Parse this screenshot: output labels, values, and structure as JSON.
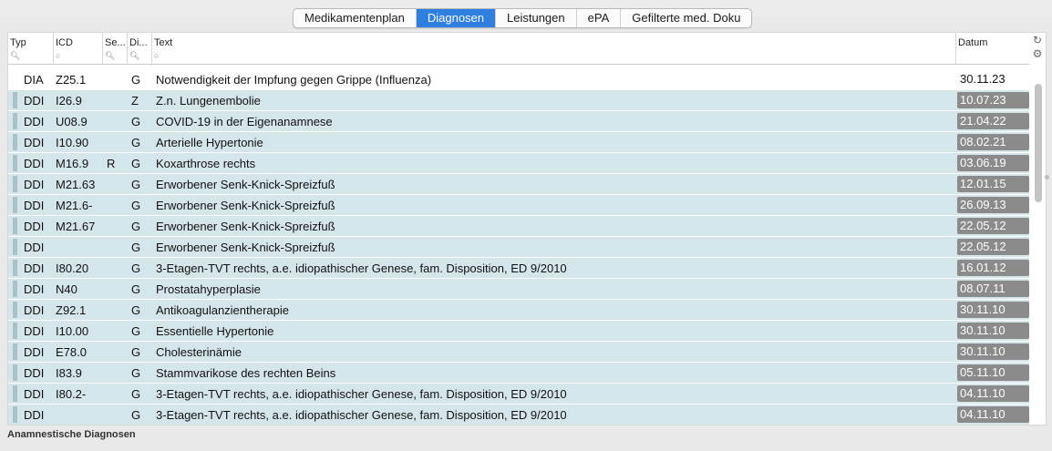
{
  "tabs": [
    {
      "label": "Medikamentenplan",
      "active": false
    },
    {
      "label": "Diagnosen",
      "active": true
    },
    {
      "label": "Leistungen",
      "active": false
    },
    {
      "label": "ePA",
      "active": false
    },
    {
      "label": "Gefilterte med. Doku",
      "active": false
    }
  ],
  "columns": {
    "typ": "Typ",
    "icd": "ICD",
    "se": "Se...",
    "di": "Di...",
    "text": "Text",
    "datum": "Datum"
  },
  "icons": {
    "refresh": "refresh-icon",
    "settings": "gear-icon",
    "search": "search-icon"
  },
  "rows": [
    {
      "typ": "DIA",
      "icd": "Z25.1",
      "se": "",
      "di": "G",
      "text": "Notwendigkeit der Impfung gegen Grippe (Influenza)",
      "datum": "30.11.23"
    },
    {
      "typ": "DDI",
      "icd": "I26.9",
      "se": "",
      "di": "Z",
      "text": "Z.n. Lungenembolie",
      "datum": "10.07.23"
    },
    {
      "typ": "DDI",
      "icd": "U08.9",
      "se": "",
      "di": "G",
      "text": "COVID-19 in der Eigenanamnese",
      "datum": "21.04.22"
    },
    {
      "typ": "DDI",
      "icd": "I10.90",
      "se": "",
      "di": "G",
      "text": "Arterielle Hypertonie",
      "datum": "08.02.21"
    },
    {
      "typ": "DDI",
      "icd": "M16.9",
      "se": "R",
      "di": "G",
      "text": "Koxarthrose rechts",
      "datum": "03.06.19"
    },
    {
      "typ": "DDI",
      "icd": "M21.63",
      "se": "",
      "di": "G",
      "text": "Erworbener Senk-Knick-Spreizfuß",
      "datum": "12.01.15"
    },
    {
      "typ": "DDI",
      "icd": "M21.6-",
      "se": "",
      "di": "G",
      "text": "Erworbener Senk-Knick-Spreizfuß",
      "datum": "26.09.13"
    },
    {
      "typ": "DDI",
      "icd": "M21.67",
      "se": "",
      "di": "G",
      "text": "Erworbener Senk-Knick-Spreizfuß",
      "datum": "22.05.12"
    },
    {
      "typ": "DDI",
      "icd": "",
      "se": "",
      "di": "G",
      "text": "Erworbener Senk-Knick-Spreizfuß",
      "datum": "22.05.12"
    },
    {
      "typ": "DDI",
      "icd": "I80.20",
      "se": "",
      "di": "G",
      "text": "3-Etagen-TVT rechts, a.e. idiopathischer Genese, fam. Disposition, ED 9/2010",
      "datum": "16.01.12"
    },
    {
      "typ": "DDI",
      "icd": "N40",
      "se": "",
      "di": "G",
      "text": "Prostatahyperplasie",
      "datum": "08.07.11"
    },
    {
      "typ": "DDI",
      "icd": "Z92.1",
      "se": "",
      "di": "G",
      "text": "Antikoagulanzientherapie",
      "datum": "30.11.10"
    },
    {
      "typ": "DDI",
      "icd": "I10.00",
      "se": "",
      "di": "G",
      "text": "Essentielle Hypertonie",
      "datum": "30.11.10"
    },
    {
      "typ": "DDI",
      "icd": "E78.0",
      "se": "",
      "di": "G",
      "text": "Cholesterinämie",
      "datum": "30.11.10"
    },
    {
      "typ": "DDI",
      "icd": "I83.9",
      "se": "",
      "di": "G",
      "text": "Stammvarikose des rechten Beins",
      "datum": "05.11.10"
    },
    {
      "typ": "DDI",
      "icd": "I80.2-",
      "se": "",
      "di": "G",
      "text": "3-Etagen-TVT rechts, a.e. idiopathischer Genese, fam. Disposition, ED 9/2010",
      "datum": "04.11.10"
    },
    {
      "typ": "DDI",
      "icd": "",
      "se": "",
      "di": "G",
      "text": "3-Etagen-TVT rechts, a.e. idiopathischer Genese, fam. Disposition, ED 9/2010",
      "datum": "04.11.10"
    }
  ],
  "footer": {
    "label": "Anamnestische Diagnosen"
  },
  "colors": {
    "active_tab": "#2f7fe0",
    "row_bg": "#d5e6ea",
    "date_badge": "#8b8b8b"
  }
}
